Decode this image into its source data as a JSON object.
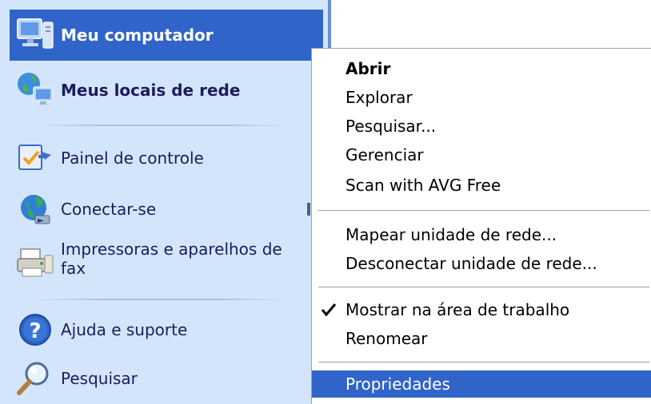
{
  "start_menu": {
    "items": [
      {
        "label": "Meu computador",
        "icon": "my-computer-icon",
        "selected": true
      },
      {
        "label": "Meus locais de rede",
        "icon": "network-places-icon"
      },
      {
        "label": "Painel de controle",
        "icon": "control-panel-icon"
      },
      {
        "label": "Conectar-se",
        "icon": "connect-icon"
      },
      {
        "label": "Impressoras e aparelhos de fax",
        "icon": "printer-icon"
      },
      {
        "label": "Ajuda e suporte",
        "icon": "help-icon"
      },
      {
        "label": "Pesquisar",
        "icon": "search-icon"
      }
    ]
  },
  "context_menu": {
    "items": [
      {
        "label": "Abrir",
        "default": true
      },
      {
        "label": "Explorar"
      },
      {
        "label": "Pesquisar..."
      },
      {
        "label": "Gerenciar"
      },
      {
        "label": "Scan with AVG Free"
      },
      {
        "label": "Mapear unidade de rede..."
      },
      {
        "label": "Desconectar unidade de rede..."
      },
      {
        "label": "Mostrar na área de trabalho",
        "checked": true
      },
      {
        "label": "Renomear"
      },
      {
        "label": "Propriedades",
        "hovered": true
      }
    ]
  },
  "colors": {
    "selection": "#3064c8",
    "start_menu_bg": "#d3e5fa",
    "text": "#1c1c5c"
  }
}
